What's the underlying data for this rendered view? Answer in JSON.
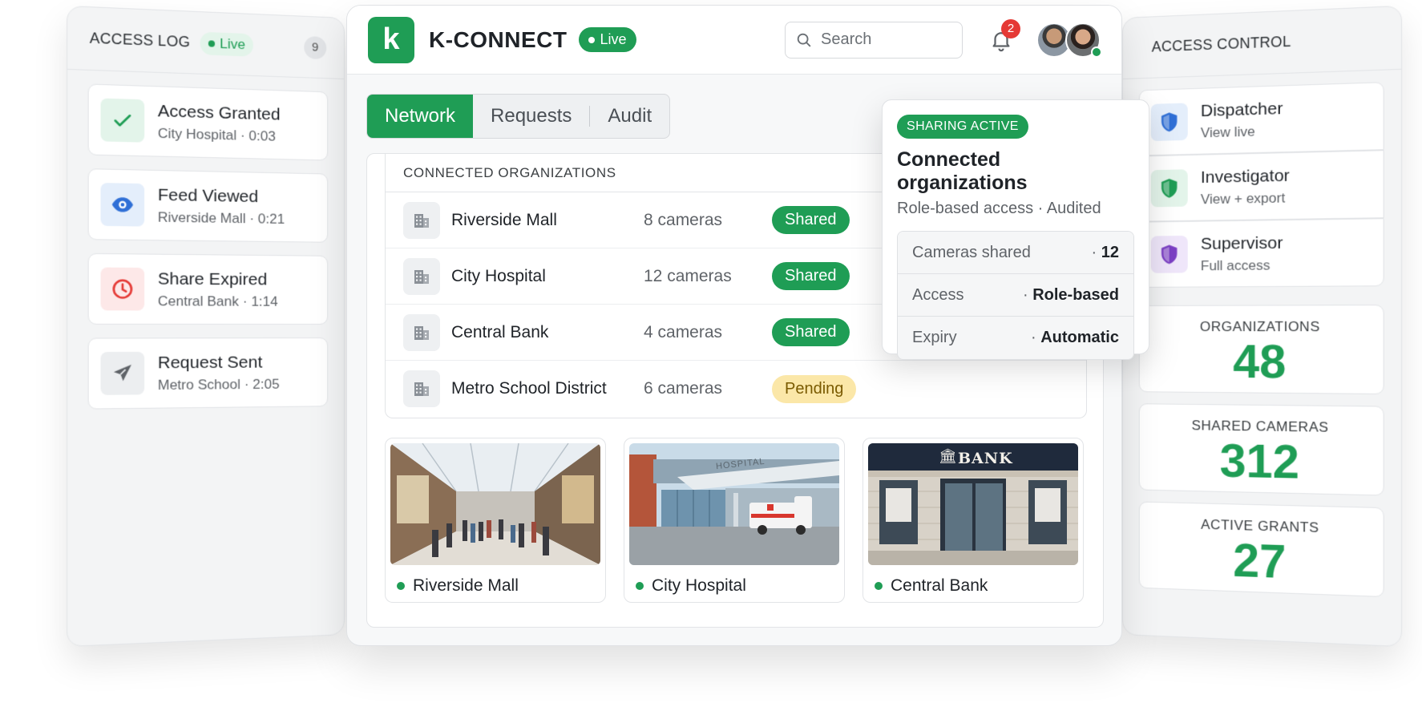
{
  "access_log": {
    "title": "ACCESS LOG",
    "live_label": "Live",
    "count": "9",
    "items": [
      {
        "title": "Access Granted",
        "sub": "City Hospital · 0:03"
      },
      {
        "title": "Feed Viewed",
        "sub": "Riverside Mall · 0:21"
      },
      {
        "title": "Share Expired",
        "sub": "Central Bank · 1:14"
      },
      {
        "title": "Request Sent",
        "sub": "Metro School · 2:05"
      }
    ]
  },
  "header": {
    "logo_letter": "k",
    "brand": "K-CONNECT",
    "live_label": "Live",
    "search_placeholder": "Search",
    "notifications": "2"
  },
  "tabs": [
    {
      "label": "Network"
    },
    {
      "label": "Requests"
    },
    {
      "label": "Audit"
    }
  ],
  "organizations": {
    "heading": "CONNECTED ORGANIZATIONS",
    "rows": [
      {
        "name": "Riverside Mall",
        "cameras": "8 cameras",
        "status": "Shared"
      },
      {
        "name": "City Hospital",
        "cameras": "12 cameras",
        "status": "Shared"
      },
      {
        "name": "Central Bank",
        "cameras": "4 cameras",
        "status": "Shared"
      },
      {
        "name": "Metro School District",
        "cameras": "6 cameras",
        "status": "Pending"
      }
    ]
  },
  "camera_feeds": [
    {
      "label": "Riverside Mall"
    },
    {
      "label": "City Hospital",
      "sign": "HOSPITAL"
    },
    {
      "label": "Central Bank",
      "sign": "BANK"
    }
  ],
  "popover": {
    "badge": "SHARING ACTIVE",
    "title": "Connected organizations",
    "subtitle": "Role-based access · Audited",
    "rows": [
      {
        "key": "Cameras shared",
        "value": "12"
      },
      {
        "key": "Access",
        "value": "Role-based"
      },
      {
        "key": "Expiry",
        "value": "Automatic"
      }
    ]
  },
  "access_control": {
    "title": "ACCESS CONTROL",
    "roles": [
      {
        "title": "Dispatcher",
        "sub": "View live",
        "color": "#2f6fd6"
      },
      {
        "title": "Investigator",
        "sub": "View + export",
        "color": "#1f9d55"
      },
      {
        "title": "Supervisor",
        "sub": "Full access",
        "color": "#7b3fc4"
      }
    ],
    "stats": [
      {
        "label": "ORGANIZATIONS",
        "value": "48"
      },
      {
        "label": "SHARED CAMERAS",
        "value": "312"
      },
      {
        "label": "ACTIVE GRANTS",
        "value": "27"
      }
    ]
  },
  "colors": {
    "accent": "#1f9d55",
    "pending": "#fbe7a8",
    "alert": "#e53935"
  }
}
